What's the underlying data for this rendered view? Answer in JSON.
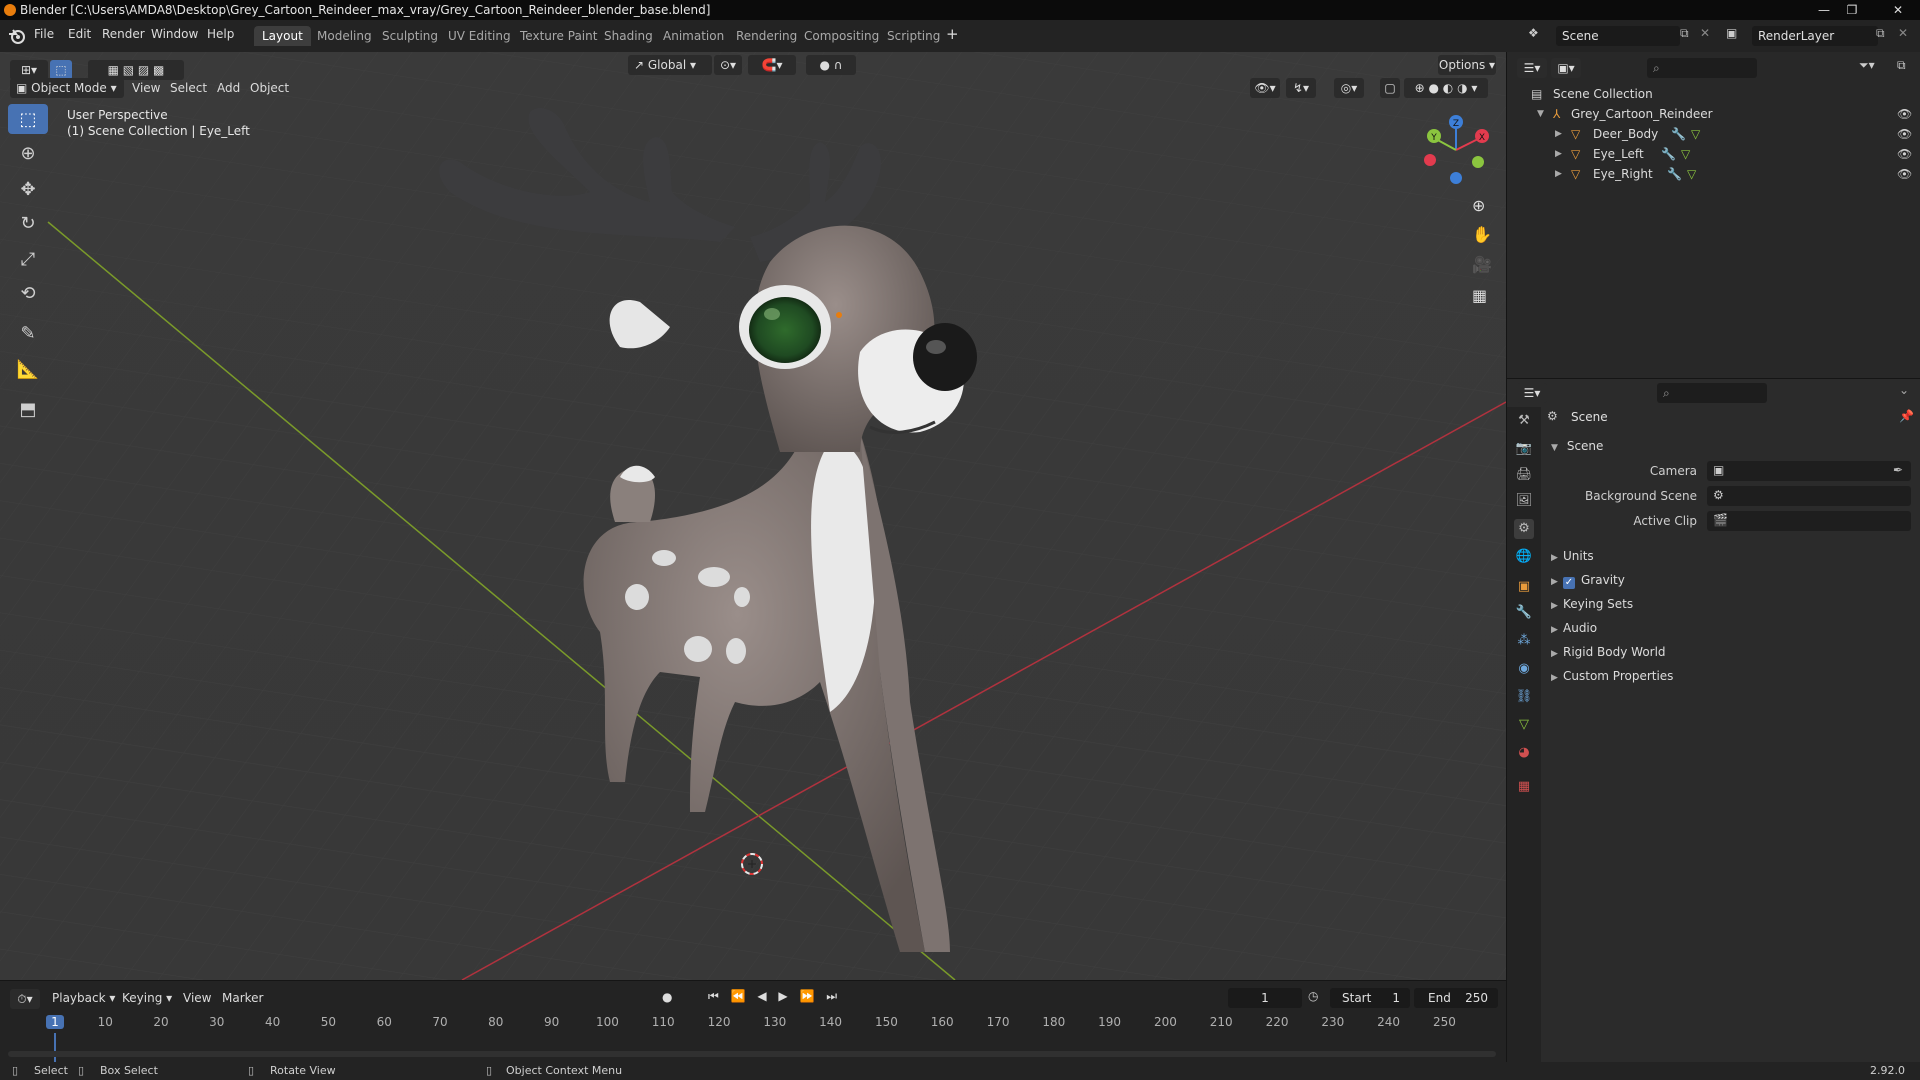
{
  "window": {
    "title": "Blender [C:\\Users\\AMDA8\\Desktop\\Grey_Cartoon_Reindeer_max_vray/Grey_Cartoon_Reindeer_blender_base.blend]",
    "controls": [
      "—",
      "❐",
      "✕"
    ]
  },
  "menu": [
    "File",
    "Edit",
    "Render",
    "Window",
    "Help"
  ],
  "workspaces": [
    "Layout",
    "Modeling",
    "Sculpting",
    "UV Editing",
    "Texture Paint",
    "Shading",
    "Animation",
    "Rendering",
    "Compositing",
    "Scripting"
  ],
  "workspace_active": "Layout",
  "add_workspace": "+",
  "scene_field": "Scene",
  "renderlayer_field": "RenderLayer",
  "viewport": {
    "mode": "Object Mode",
    "menus": [
      "View",
      "Select",
      "Add",
      "Object"
    ],
    "transform_orientation": "Global",
    "options_label": "Options",
    "overlay_line1": "User Perspective",
    "overlay_line2": "(1) Scene Collection | Eye_Left",
    "gizmo_axes": {
      "x": "X",
      "y": "Y",
      "z": "Z"
    }
  },
  "outliner": {
    "root": "Scene Collection",
    "collection": "Grey_Cartoon_Reindeer",
    "objects": [
      "Deer_Body",
      "Eye_Left",
      "Eye_Right"
    ]
  },
  "properties": {
    "header": "Scene",
    "section": "Scene",
    "fields": [
      {
        "label": "Camera",
        "value": ""
      },
      {
        "label": "Background Scene",
        "value": ""
      },
      {
        "label": "Active Clip",
        "value": ""
      }
    ],
    "panels": [
      {
        "label": "Units",
        "checkbox": false
      },
      {
        "label": "Gravity",
        "checkbox": true
      },
      {
        "label": "Keying Sets",
        "checkbox": false
      },
      {
        "label": "Audio",
        "checkbox": false
      },
      {
        "label": "Rigid Body World",
        "checkbox": false
      },
      {
        "label": "Custom Properties",
        "checkbox": false
      }
    ]
  },
  "timeline": {
    "menus": [
      "Playback",
      "Keying",
      "View",
      "Marker"
    ],
    "current_frame": "1",
    "start_label": "Start",
    "start_value": "1",
    "end_label": "End",
    "end_value": "250",
    "ticks": [
      "1",
      "10",
      "20",
      "30",
      "40",
      "50",
      "60",
      "70",
      "80",
      "90",
      "100",
      "110",
      "120",
      "130",
      "140",
      "150",
      "160",
      "170",
      "180",
      "190",
      "200",
      "210",
      "220",
      "230",
      "240",
      "250"
    ]
  },
  "statusbar": {
    "items": [
      "Select",
      "Box Select",
      "Rotate View",
      "Object Context Menu"
    ],
    "version": "2.92.0"
  },
  "colors": {
    "accent": "#4772b3",
    "x_axis": "#e23b4e",
    "y_axis": "#8bc53f",
    "z_axis": "#3d7fd8"
  }
}
